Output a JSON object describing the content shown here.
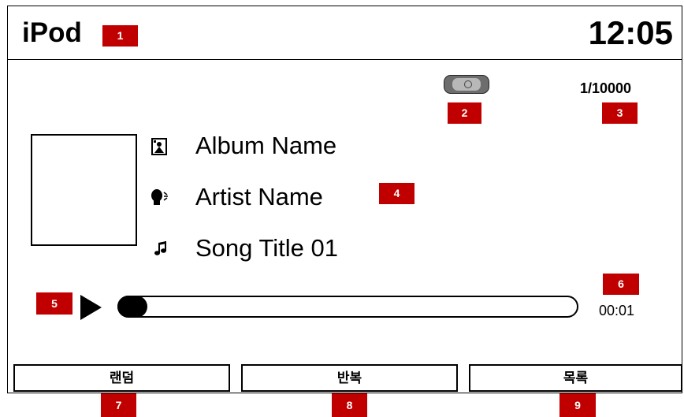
{
  "header": {
    "title": "iPod",
    "clock": "12:05"
  },
  "markers": [
    "1",
    "2",
    "3",
    "4",
    "5",
    "6",
    "7",
    "8",
    "9"
  ],
  "status": {
    "mode_icon": "play-mode-icon",
    "track_count": "1/10000"
  },
  "now_playing": {
    "album_name": "Album Name",
    "artist_name": "Artist Name",
    "song_title": "Song Title 01",
    "album_icon": "album-icon",
    "artist_icon": "artist-icon",
    "song_icon": "music-note-icon"
  },
  "playback": {
    "state": "playing",
    "elapsed": "00:01",
    "progress": 0.01
  },
  "buttons": {
    "random": "랜덤",
    "repeat": "반복",
    "list": "목록"
  },
  "colors": {
    "marker": "#c00000",
    "mode_icon": "#6d6d6d"
  }
}
